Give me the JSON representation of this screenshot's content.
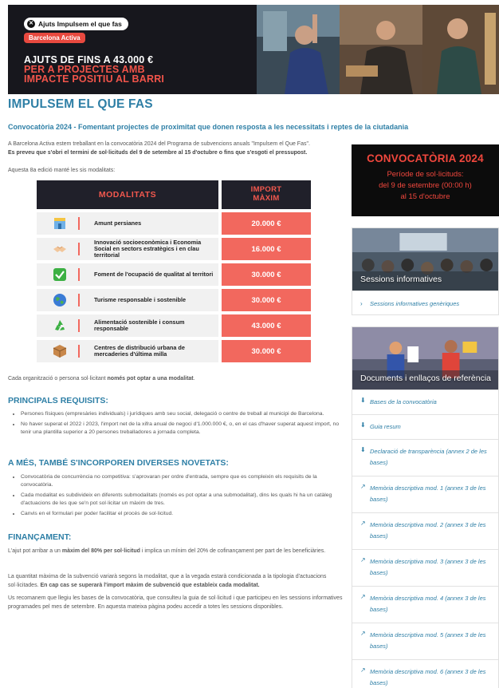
{
  "hero": {
    "pill": "Ajuts Impulsem el que fas",
    "brand": "Barcelona Activa",
    "line1": "AJUTS DE FINS A 43.000 €",
    "line2": "PER A PROJECTES AMB",
    "line3": "IMPACTE POSITIU AL BARRI"
  },
  "main": {
    "title": "IMPULSEM EL QUE FAS",
    "subtitle": "Convocatòria 2024  - Fomentant projectes de proximitat que donen resposta a les necessitats i reptes de la ciutadania",
    "intro_1": "A Barcelona Activa estem treballant en la convocatòria 2024 del Programa de subvencions anuals \"Impulsem el Que Fas\".",
    "intro_2": "Es preveu que s'obri el termini de sol·licituds del 9 de setembre al 15 d'octubre o fins que s'esgoti el pressupost.",
    "intro_3": "Aquesta 8a edició manté les sis modalitats:",
    "modalities": {
      "header_left": "MODALITATS",
      "header_right_1": "IMPORT",
      "header_right_2": "MÀXIM",
      "rows": [
        {
          "icon": "storefront-icon",
          "label": "Amunt persianes",
          "amount": "20.000 €"
        },
        {
          "icon": "handshake-icon",
          "label": "Innovació socioeconòmica i Economia Social en sectors estratègics i en clau territorial",
          "amount": "16.000 €"
        },
        {
          "icon": "checkmark-icon",
          "label": "Foment de l'ocupació de qualitat al territori",
          "amount": "30.000 €"
        },
        {
          "icon": "globe-icon",
          "label": "Turisme responsable i sostenible",
          "amount": "30.000 €"
        },
        {
          "icon": "recycle-icon",
          "label": "Alimentació sostenible i consum responsable",
          "amount": "43.000 €"
        },
        {
          "icon": "package-icon",
          "label": "Centres de distribució urbana de mercaderies d'última milla",
          "amount": "30.000 €"
        }
      ]
    },
    "note_pre": "Cada organització o persona sol·licitant ",
    "note_bold": "només pot optar a una modalitat",
    "note_post": ".",
    "requirements": {
      "heading": "PRINCIPALS REQUISITS:",
      "items": [
        "Persones físiques (empresàries individuals) i jurídiques amb seu social, delegació o centre de treball al municipi de Barcelona.",
        "No haver superat el 2022 i 2023, l'import net de la xifra anual de negoci d'1.000.000 €, o, en el cas d'haver superat aquest import, no tenir una plantilla superior a 20 persones treballadores a jornada completa."
      ]
    },
    "novelties": {
      "heading": "A MÉS, TAMBÉ S'INCORPOREN DIVERSES NOVETATS:",
      "items": [
        "Convocatòria de concurrència no competitiva: s'aprovaran per ordre d'entrada, sempre que es compleixin els requisits de la convocatòria.",
        "Cada modalitat es subdivideix en diferents submodalitats (només es pot optar a una submodalitat), dins les quals hi ha un catàleg d'actuacions de les que se'n pot sol·licitar un màxim de tres.",
        "Canvis en el formulari per poder facilitar el procés de sol·licitud."
      ]
    },
    "financing": {
      "heading": "FINANÇAMENT:",
      "p1_pre": "L'ajut pot arribar a un ",
      "p1_bold": "màxim del 80% per sol·licitud",
      "p1_post": " i implica un mínim del 20% de cofinançament per part de les beneficiàries.",
      "p2_pre": "La quantitat màxima de la subvenció variarà segons la modalitat, que a la vegada estarà condicionada a la tipologia d'actuacions sol·licitades. ",
      "p2_bold": "En cap cas se superarà l'import màxim de subvenció que estableix cada modalitat.",
      "p3": "Us recomanem que llegiu les bases de la convocatòria, que consulteu la guia de sol·licitud i que participeu en les sessions informatives programades pel mes de setembre. En aquesta mateixa pàgina podeu accedir a totes les sessions disponibles."
    }
  },
  "sidebar": {
    "convocatoria": {
      "title": "CONVOCATÒRIA 2024",
      "line1": "Període de sol·licituds:",
      "line2": "del 9 de setembre (00:00 h)",
      "line3": "al 15 d'octubre"
    },
    "sessions": {
      "title": "Sessions informatives",
      "link": "Sessions informatives genèriques"
    },
    "documents": {
      "title": "Documents i enllaços de referència",
      "links": [
        {
          "icon": "download-icon",
          "label": "Bases de la convocatòria"
        },
        {
          "icon": "download-icon",
          "label": "Guia resum"
        },
        {
          "icon": "download-icon",
          "label": "Declaració de transparència (annex 2 de les bases)"
        },
        {
          "icon": "external-link-icon",
          "label": "Memòria descriptiva mod. 1 (annex 3 de les bases)"
        },
        {
          "icon": "external-link-icon",
          "label": "Memòria descriptiva mod. 2 (annex 3 de les bases)"
        },
        {
          "icon": "external-link-icon",
          "label": "Memòria descriptiva mod. 3 (annex 3 de les bases)"
        },
        {
          "icon": "external-link-icon",
          "label": "Memòria descriptiva mod. 4 (annex 3 de les bases)"
        },
        {
          "icon": "external-link-icon",
          "label": "Memòria descriptiva mod. 5 (annex 3 de les bases)"
        },
        {
          "icon": "external-link-icon",
          "label": "Memòria descriptiva mod. 6 (annex 3 de les bases)"
        }
      ]
    }
  },
  "colors": {
    "accent_blue": "#2e7fa6",
    "coral": "#f2685e",
    "dark": "#20202a"
  }
}
